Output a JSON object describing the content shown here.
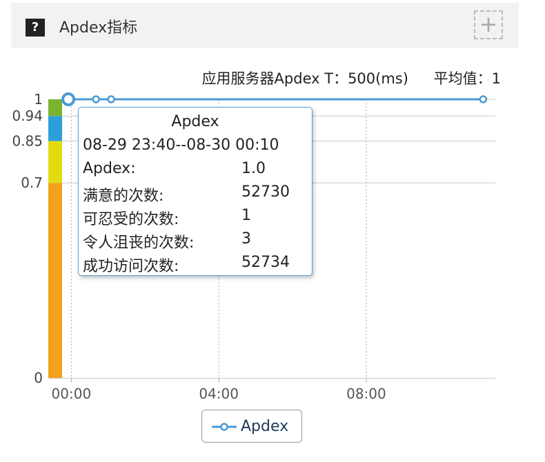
{
  "header": {
    "help_icon": "question-icon",
    "help_glyph": "?",
    "title": "Apdex指标",
    "expand_icon": "plus-icon",
    "expand_glyph": "+"
  },
  "info": {
    "threshold_label": "应用服务器Apdex T：500(ms)",
    "average_label": "平均值：1"
  },
  "colors": {
    "line": "#4a9ad4",
    "band_top": "#7ab32e",
    "band_blue": "#2d9fd8",
    "band_yellow": "#e3db0f",
    "band_orange": "#f2a31b"
  },
  "chart_data": {
    "type": "line",
    "x": [
      "23:55",
      "00:40",
      "01:05",
      "11:10"
    ],
    "series": [
      {
        "name": "Apdex",
        "values": [
          1,
          1,
          1,
          1
        ]
      }
    ],
    "xticks": [
      "00:00",
      "04:00",
      "08:00"
    ],
    "xtick_hours": [
      0,
      4,
      8
    ],
    "xlim_hours": [
      -0.25,
      11.5
    ],
    "yticks": [
      "0",
      "0.7",
      "0.85",
      "0.94",
      "1"
    ],
    "ytick_values": [
      0,
      0.7,
      0.85,
      0.94,
      1
    ],
    "ylim": [
      0,
      1
    ],
    "bands": [
      {
        "from": 0,
        "to": 0.7,
        "color": "#f2a31b"
      },
      {
        "from": 0.7,
        "to": 0.85,
        "color": "#e3db0f"
      },
      {
        "from": 0.85,
        "to": 0.94,
        "color": "#2d9fd8"
      },
      {
        "from": 0.94,
        "to": 1,
        "color": "#7ab32e"
      }
    ],
    "point_hours": [
      -0.08,
      0.67,
      1.08,
      11.17
    ],
    "grid": true,
    "legend": "bottom"
  },
  "tooltip": {
    "title": "Apdex",
    "range": "08-29 23:40--08-30 00:10",
    "rows": [
      {
        "label": "Apdex:",
        "value": "1.0"
      },
      {
        "label": "满意的次数:",
        "value": "52730"
      },
      {
        "label": "可忍受的次数:",
        "value": "1"
      },
      {
        "label": "令人沮丧的次数:",
        "value": "3"
      },
      {
        "label": "成功访问次数:",
        "value": "52734"
      }
    ]
  },
  "legend": {
    "label": "Apdex",
    "icon": "line-marker-icon"
  }
}
